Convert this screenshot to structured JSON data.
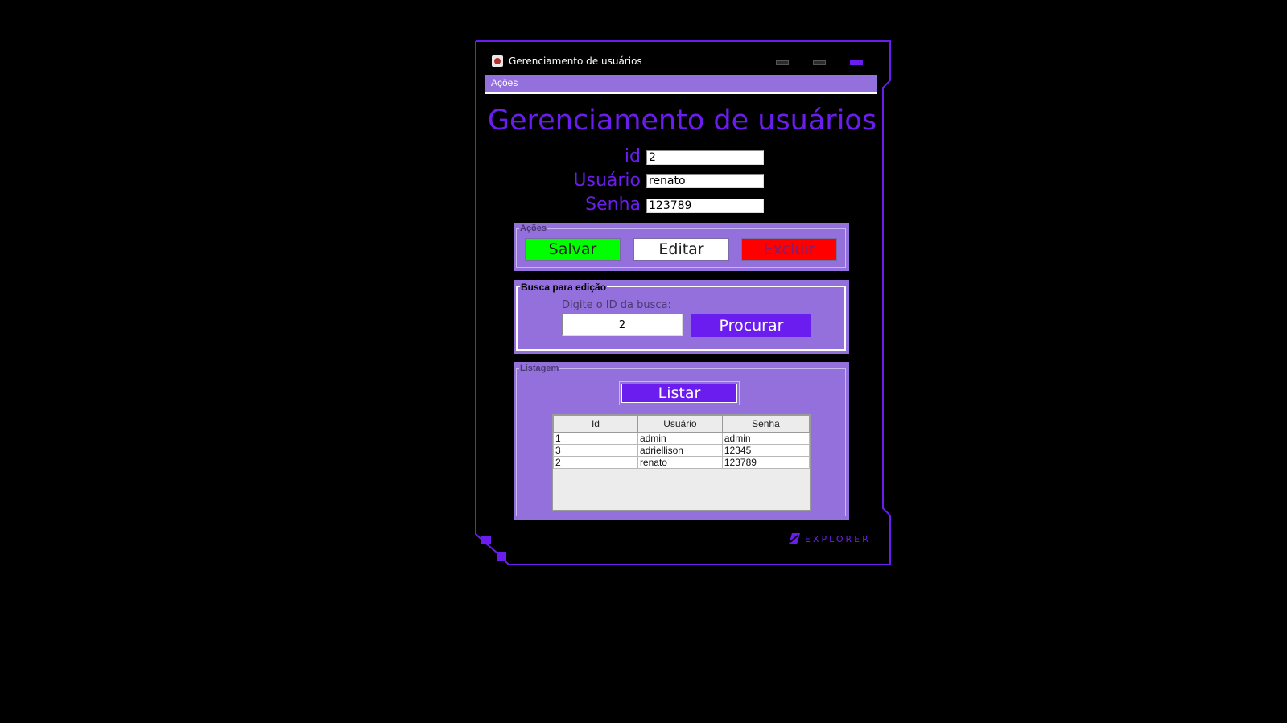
{
  "window": {
    "title": "Gerenciamento de usuários",
    "accent_color": "#6b1df0",
    "panel_color": "#9370db",
    "brand": "EXPLORER"
  },
  "menubar": {
    "items": [
      {
        "label": "Ações"
      }
    ]
  },
  "form": {
    "heading": "Gerenciamento de usuários",
    "id_label": "id",
    "id_value": "2",
    "user_label": "Usuário",
    "user_value": "renato",
    "password_label": "Senha",
    "password_value": "123789"
  },
  "actions": {
    "legend": "Ações",
    "save_label": "Salvar",
    "save_color": "#00ff00",
    "edit_label": "Editar",
    "delete_label": "Excluir",
    "delete_color": "#ff0000"
  },
  "search": {
    "legend": "Busca para edição",
    "prompt": "Digite o ID da busca:",
    "value": "2",
    "button_label": "Procurar"
  },
  "listing": {
    "legend": "Listagem",
    "button_label": "Listar",
    "columns": [
      "Id",
      "Usuário",
      "Senha"
    ],
    "rows": [
      [
        "1",
        "admin",
        "admin"
      ],
      [
        "3",
        "adriellison",
        "12345"
      ],
      [
        "2",
        "renato",
        "123789"
      ]
    ]
  }
}
